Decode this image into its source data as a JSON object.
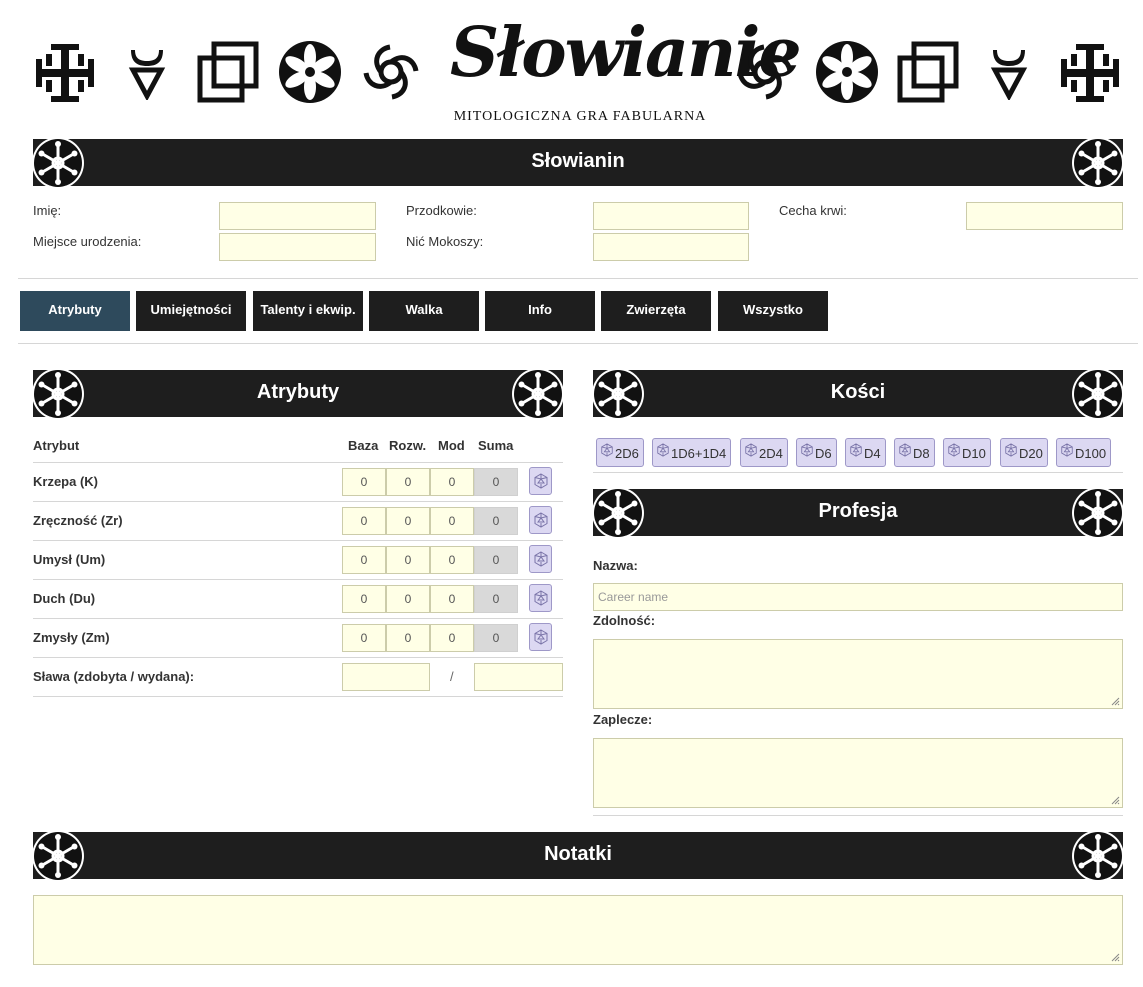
{
  "logo": {
    "title": "Słowianie",
    "subtitle": "MITOLOGICZNA GRA FABULARNA"
  },
  "character": {
    "header": "Słowianin",
    "fields": {
      "name_label": "Imię:",
      "ancestors_label": "Przodkowie:",
      "blood_trait_label": "Cecha krwi:",
      "birthplace_label": "Miejsce urodzenia:",
      "mokosh_thread_label": "Nić Mokoszy:"
    }
  },
  "tabs": [
    {
      "label": "Atrybuty",
      "active": true
    },
    {
      "label": "Umiejętności",
      "active": false
    },
    {
      "label": "Talenty i ekwip.",
      "active": false
    },
    {
      "label": "Walka",
      "active": false
    },
    {
      "label": "Info",
      "active": false
    },
    {
      "label": "Zwierzęta",
      "active": false
    },
    {
      "label": "Wszystko",
      "active": false
    }
  ],
  "attributes": {
    "header": "Atrybuty",
    "columns": {
      "attribute": "Atrybut",
      "base": "Baza",
      "development": "Rozw.",
      "mod": "Mod",
      "sum": "Suma"
    },
    "rows": [
      {
        "label": "Krzepa (K)",
        "base": "0",
        "dev": "0",
        "mod": "0",
        "sum": "0"
      },
      {
        "label": "Zręczność (Zr)",
        "base": "0",
        "dev": "0",
        "mod": "0",
        "sum": "0"
      },
      {
        "label": "Umysł (Um)",
        "base": "0",
        "dev": "0",
        "mod": "0",
        "sum": "0"
      },
      {
        "label": "Duch (Du)",
        "base": "0",
        "dev": "0",
        "mod": "0",
        "sum": "0"
      },
      {
        "label": "Zmysły (Zm)",
        "base": "0",
        "dev": "0",
        "mod": "0",
        "sum": "0"
      }
    ],
    "fame_label": "Sława (zdobyta / wydana):",
    "fame_separator": "/"
  },
  "dice": {
    "header": "Kości",
    "buttons": [
      "2D6",
      "1D6+1D4",
      "2D4",
      "D6",
      "D4",
      "D8",
      "D10",
      "D20",
      "D100"
    ]
  },
  "profession": {
    "header": "Profesja",
    "name_label": "Nazwa:",
    "name_placeholder": "Career name",
    "ability_label": "Zdolność:",
    "background_label": "Zaplecze:"
  },
  "notes": {
    "header": "Notatki"
  },
  "colors": {
    "bar": "#1e1e1e",
    "active_tab": "#2e4a5c",
    "input_bg": "#ffffe6",
    "button_bg": "#dcd8f2"
  }
}
